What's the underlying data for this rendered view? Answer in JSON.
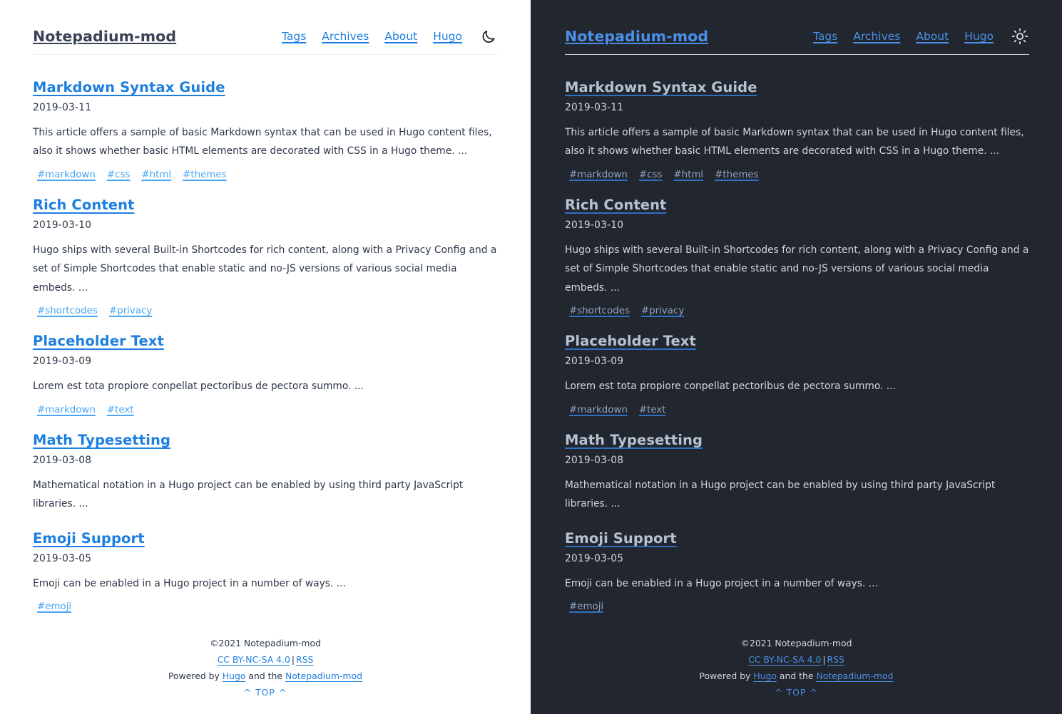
{
  "site": {
    "title": "Notepadium-mod",
    "nav": [
      {
        "label": "Tags"
      },
      {
        "label": "Archives"
      },
      {
        "label": "About"
      },
      {
        "label": "Hugo"
      }
    ],
    "theme_toggle_light": "moon-icon",
    "theme_toggle_dark": "sun-icon"
  },
  "posts": [
    {
      "title": "Markdown Syntax Guide",
      "date": "2019-03-11",
      "summary": "This article offers a sample of basic Markdown syntax that can be used in Hugo content files, also it shows whether basic HTML elements are decorated with CSS in a Hugo theme. ...",
      "tags": [
        "#markdown",
        "#css",
        "#html",
        "#themes"
      ]
    },
    {
      "title": "Rich Content",
      "date": "2019-03-10",
      "summary": "Hugo ships with several Built-in Shortcodes for rich content, along with a Privacy Config and a set of Simple Shortcodes that enable static and no-JS versions of various social media embeds. ...",
      "tags": [
        "#shortcodes",
        "#privacy"
      ]
    },
    {
      "title": "Placeholder Text",
      "date": "2019-03-09",
      "summary": "Lorem est tota propiore conpellat pectoribus de pectora summo. ...",
      "tags": [
        "#markdown",
        "#text"
      ]
    },
    {
      "title": "Math Typesetting",
      "date": "2019-03-08",
      "summary": "Mathematical notation in a Hugo project can be enabled by using third party JavaScript libraries. ...",
      "tags": []
    },
    {
      "title": "Emoji Support",
      "date": "2019-03-05",
      "summary": "Emoji can be enabled in a Hugo project in a number of ways. ...",
      "tags": [
        "#emoji"
      ]
    }
  ],
  "footer": {
    "copyright": "©2021 Notepadium-mod",
    "license": "CC BY-NC-SA 4.0",
    "separator": "|",
    "rss": "RSS",
    "powered_prefix": "Powered by",
    "powered_engine": "Hugo",
    "powered_middle": "and the",
    "powered_theme": "Notepadium-mod",
    "to_top": "^ TOP ^"
  },
  "colors": {
    "light_bg": "#ffffff",
    "dark_bg": "#22262e",
    "light_title": "#3a4258",
    "dark_title": "#4a90e8",
    "link_blue": "#1d7fe0",
    "tag_blue": "#49a5f5",
    "dark_text": "#cfd6e1"
  }
}
